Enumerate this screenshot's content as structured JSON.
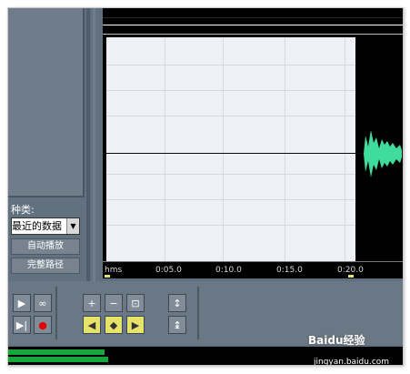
{
  "left_panel": {
    "type_label": "种类:",
    "type_value": "最近的数据",
    "button_autoplay": "自动播放",
    "button_fullpath": "完整路径"
  },
  "ruler": {
    "labels": [
      "hms",
      "0:05.0",
      "0:10.0",
      "0:15.0",
      "0:20.0"
    ]
  },
  "watermark": {
    "text": "Baidu经验",
    "url": "jingyan.baidu.com"
  },
  "colors": {
    "waveform": "#3fdc9e",
    "selection": "#eef0f5",
    "level_meter": "#17a63c"
  }
}
